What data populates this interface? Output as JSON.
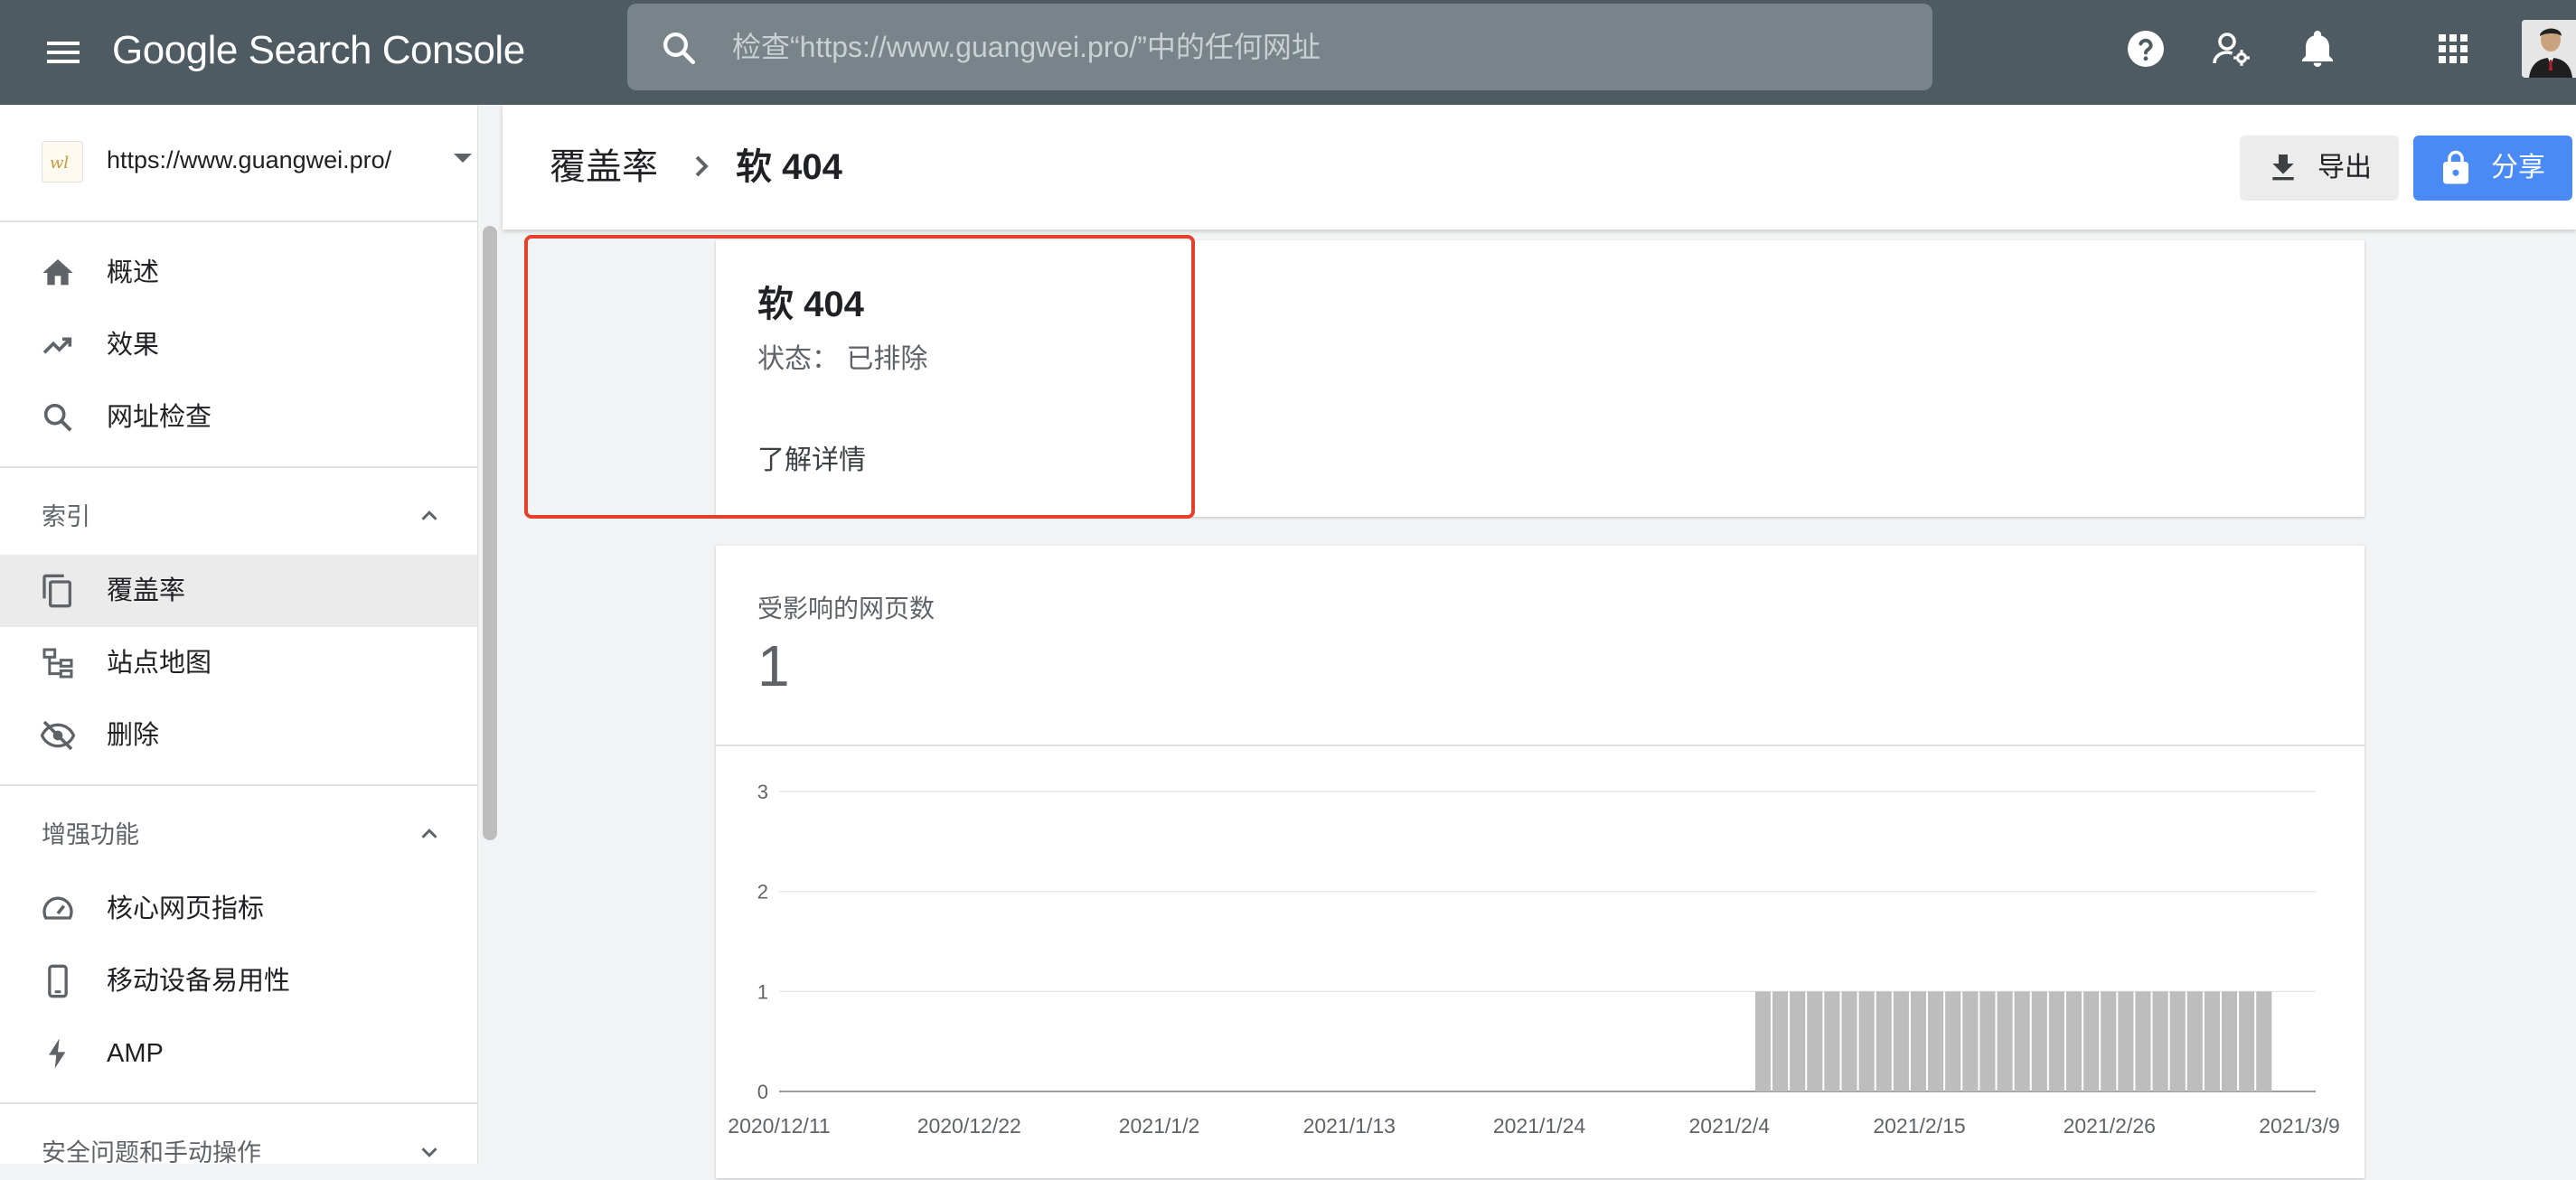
{
  "app": {
    "title": "Google Search Console",
    "menu_icon": "menu-icon"
  },
  "search": {
    "placeholder": "检查“https://www.guangwei.pro/”中的任何网址",
    "icon": "search-icon"
  },
  "topbar_icons": [
    "help-icon",
    "manage-users-icon",
    "notifications-icon",
    "apps-grid-icon"
  ],
  "property": {
    "url": "https://www.guangwei.pro/"
  },
  "sidebar": {
    "main_items": [
      {
        "label": "概述",
        "icon": "home-icon"
      },
      {
        "label": "效果",
        "icon": "trending-up-icon"
      },
      {
        "label": "网址检查",
        "icon": "search-icon"
      }
    ],
    "index_section": {
      "title": "索引",
      "items": [
        {
          "label": "覆盖率",
          "icon": "copy-icon",
          "active": true
        },
        {
          "label": "站点地图",
          "icon": "sitemap-icon"
        },
        {
          "label": "删除",
          "icon": "visibility-off-icon"
        }
      ]
    },
    "enhancements_section": {
      "title": "增强功能",
      "items": [
        {
          "label": "核心网页指标",
          "icon": "speed-icon"
        },
        {
          "label": "移动设备易用性",
          "icon": "phone-icon"
        },
        {
          "label": "AMP",
          "icon": "bolt-icon"
        }
      ]
    },
    "security_section": {
      "title": "安全问题和手动操作"
    }
  },
  "header": {
    "breadcrumb_parent": "覆盖率",
    "breadcrumb_current": "软 404",
    "export_label": "导出",
    "share_label": "分享"
  },
  "issue": {
    "title": "软 404",
    "status": "状态： 已排除",
    "learn_more": "了解详情"
  },
  "metric": {
    "label": "受影响的网页数",
    "value": "1"
  },
  "colors": {
    "topbar": "#4f5b62",
    "accent_blue": "#4a8af4",
    "highlight_red": "#e4402d",
    "bar_gray": "#bdbdbd"
  },
  "chart_data": {
    "type": "bar",
    "title": "",
    "xlabel": "",
    "ylabel": "",
    "ylim": [
      0,
      3
    ],
    "yticks": [
      0,
      1,
      2,
      3
    ],
    "xticks": [
      "2020/12/11",
      "2020/12/22",
      "2021/1/2",
      "2021/1/13",
      "2021/1/24",
      "2021/2/4",
      "2021/2/15",
      "2021/2/26",
      "2021/3/9"
    ],
    "x_start": "2020/12/11",
    "x_end": "2021/3/9",
    "nonzero_start": "2021/2/6",
    "nonzero_end": "2021/3/7",
    "nonzero_value": 1,
    "grid": true
  }
}
